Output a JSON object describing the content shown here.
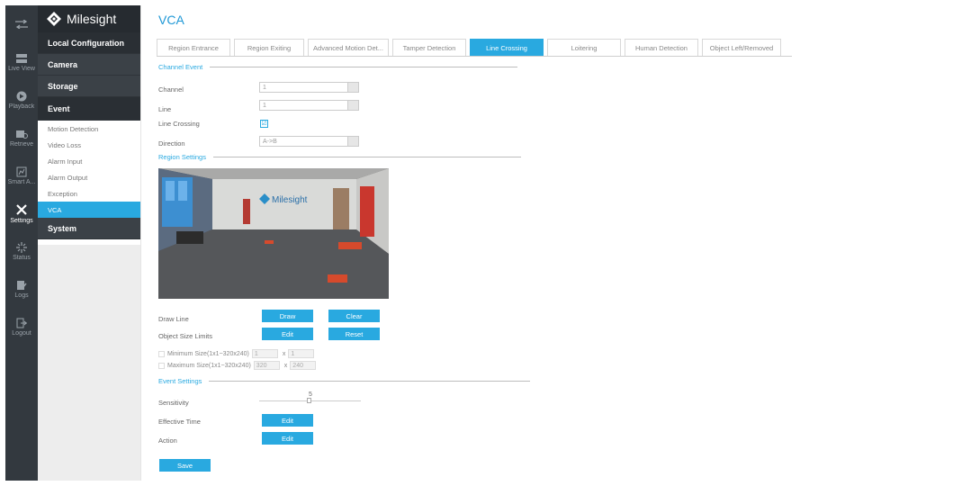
{
  "rail": {
    "items": [
      {
        "icon": "live-view-icon",
        "label": "Live View"
      },
      {
        "icon": "playback-icon",
        "label": "Playback"
      },
      {
        "icon": "retrieve-icon",
        "label": "Retrieve"
      },
      {
        "icon": "smart-analysis-icon",
        "label": "Smart A..."
      },
      {
        "icon": "settings-icon",
        "label": "Settings"
      },
      {
        "icon": "status-icon",
        "label": "Status"
      },
      {
        "icon": "logs-icon",
        "label": "Logs"
      },
      {
        "icon": "logout-icon",
        "label": "Logout"
      }
    ]
  },
  "nav": {
    "logo_text": "Milesight",
    "local_configuration": "Local Configuration",
    "camera": "Camera",
    "storage": "Storage",
    "event": "Event",
    "event_items": [
      "Motion Detection",
      "Video Loss",
      "Alarm Input",
      "Alarm Output",
      "Exception",
      "VCA"
    ],
    "system": "System"
  },
  "page": {
    "title": "VCA",
    "tabs": [
      "Region Entrance",
      "Region Exiting",
      "Advanced Motion Det...",
      "Tamper Detection",
      "Line Crossing",
      "Loitering",
      "Human Detection",
      "Object Left/Removed"
    ],
    "active_tab": "Line Crossing"
  },
  "channel_event": {
    "section": "Channel Event",
    "channel_label": "Channel",
    "channel_value": "1",
    "line_label": "Line",
    "line_value": "1",
    "line_crossing_label": "Line Crossing",
    "line_crossing_checked": "☑",
    "direction_label": "Direction",
    "direction_value": "A->B"
  },
  "region_settings": {
    "section": "Region Settings",
    "preview_logo_text": "Milesight",
    "draw_line_label": "Draw Line",
    "draw_button": "Draw",
    "clear_button": "Clear",
    "object_size_label": "Object Size Limits",
    "edit_button": "Edit",
    "reset_button": "Reset",
    "min_label": "Minimum Size(1x1~320x240)",
    "min_w": "1",
    "min_h": "1",
    "max_label": "Maximum Size(1x1~320x240)",
    "max_w": "320",
    "max_h": "240",
    "x": "x"
  },
  "event_settings": {
    "section": "Event Settings",
    "sensitivity_label": "Sensitivity",
    "sensitivity_value": "5",
    "effective_time_label": "Effective Time",
    "effective_time_button": "Edit",
    "action_label": "Action",
    "action_button": "Edit",
    "save_button": "Save"
  },
  "colors": {
    "accent": "#29a9e0",
    "rail_bg": "#33393f",
    "title": "#1f98d6"
  }
}
